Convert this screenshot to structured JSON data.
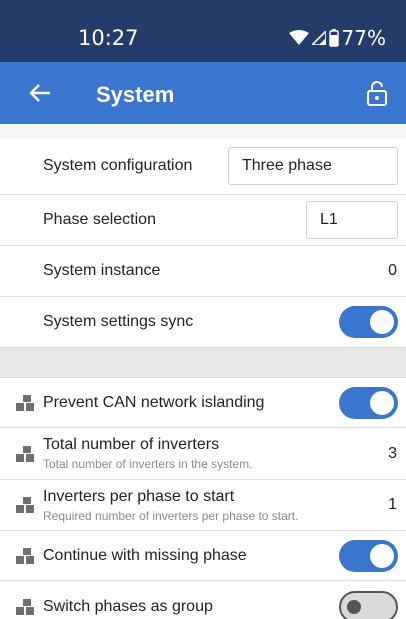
{
  "status_bar": {
    "time": "10:27",
    "battery": "77%"
  },
  "app_bar": {
    "title": "System"
  },
  "settings": {
    "system_configuration": {
      "label": "System configuration",
      "value": "Three phase"
    },
    "phase_selection": {
      "label": "Phase selection",
      "value": "L1"
    },
    "system_instance": {
      "label": "System instance",
      "value": "0"
    },
    "system_settings_sync": {
      "label": "System settings sync",
      "enabled": true
    },
    "prevent_can_islanding": {
      "label": "Prevent CAN network islanding",
      "enabled": true
    },
    "total_inverters": {
      "label": "Total number of inverters",
      "description": "Total number of inverters in the system.",
      "value": "3"
    },
    "inverters_per_phase": {
      "label": "Inverters per phase to start",
      "description": "Required number of inverters per phase to start.",
      "value": "1"
    },
    "continue_missing_phase": {
      "label": "Continue with missing phase",
      "enabled": true
    },
    "switch_phases_group": {
      "label": "Switch phases as group",
      "enabled": false
    }
  },
  "colors": {
    "status_bar": "#233d6b",
    "app_bar": "#3a76d0",
    "toggle_on": "#3a76d0"
  }
}
